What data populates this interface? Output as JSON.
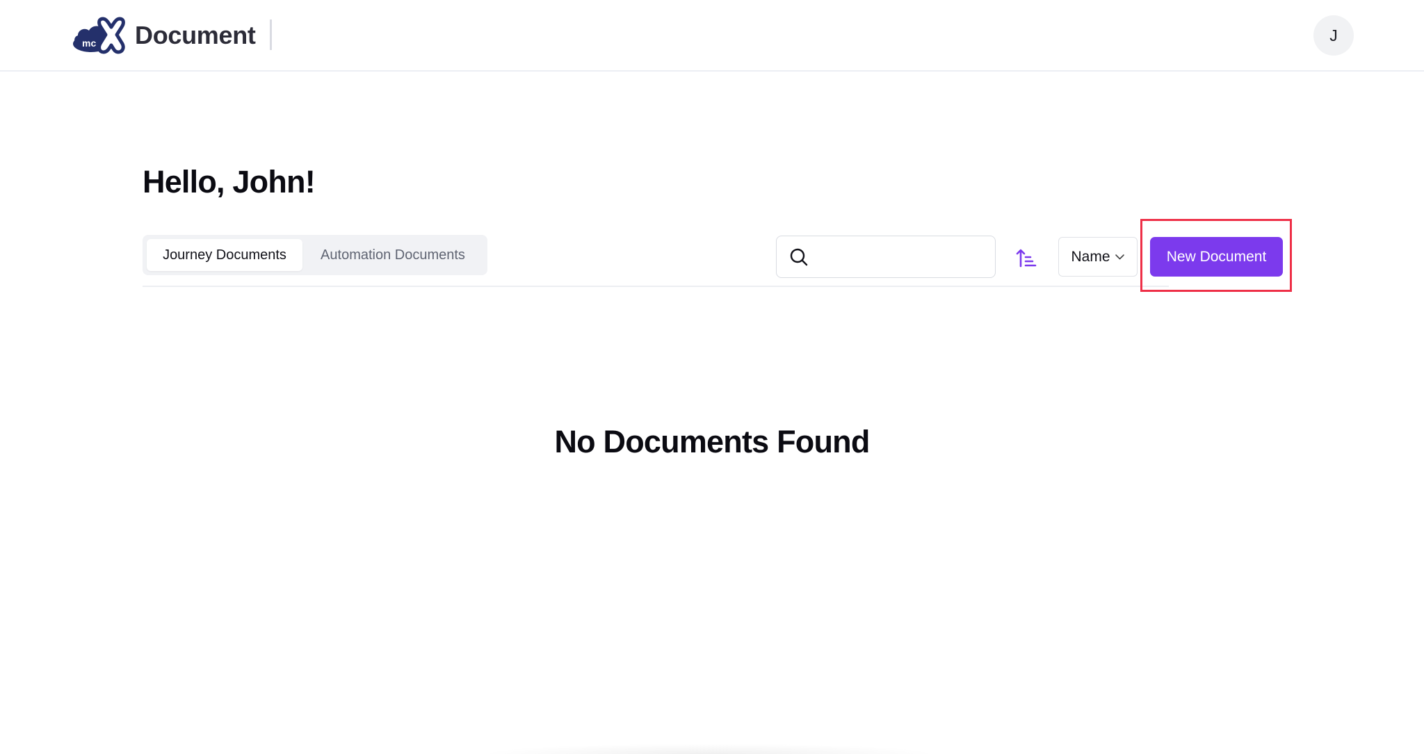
{
  "header": {
    "logo_text": "mc",
    "app_title": "Document",
    "avatar_initial": "J"
  },
  "main": {
    "greeting": "Hello, John!",
    "tabs": [
      {
        "label": "Journey Documents",
        "active": true
      },
      {
        "label": "Automation Documents",
        "active": false
      }
    ],
    "search": {
      "value": "",
      "placeholder": ""
    },
    "sort_direction_icon": "sort-ascending-icon",
    "sort_by": "Name",
    "new_document_label": "New Document",
    "empty_message": "No Documents Found"
  },
  "colors": {
    "accent": "#7c3aed",
    "brand_navy": "#24306b",
    "highlight_box": "#ee2f47"
  }
}
